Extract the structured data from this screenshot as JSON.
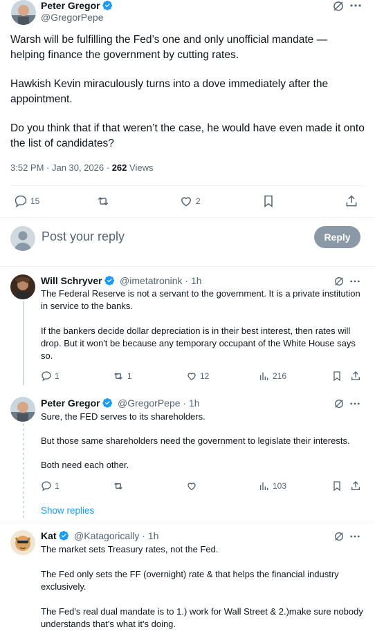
{
  "main_tweet": {
    "author_name": "Peter Gregor",
    "author_handle": "@GregorPepe",
    "paragraphs": [
      "Warsh will be fulfilling the Fed’s one and only unofficial mandate — helping finance the government by cutting rates.",
      "Hawkish Kevin miraculously turns into a dove immediately after the appointment.",
      "Do you think that if that weren’t the case, he would have even made it onto the list of candidates?"
    ],
    "timestamp": "3:52 PM · Jan 30, 2026 · ",
    "views_count": "262",
    "views_label": " Views",
    "replies": "15",
    "reposts": "",
    "likes": "2"
  },
  "composer": {
    "placeholder": "Post your reply",
    "button_label": "Reply"
  },
  "replies": [
    {
      "name": "Will Schryver",
      "handle": "@imetatronink · 1h",
      "paragraphs": [
        "The Federal Reserve is not a servant to the government. It is a private institution in service to the banks.",
        "If the bankers decide dollar depreciation is in their best interest, then rates will drop. But it won't be because any temporary occupant of the White House says so."
      ],
      "replies": "1",
      "reposts": "1",
      "likes": "12",
      "views": "216"
    },
    {
      "name": "Peter Gregor",
      "handle": "@GregorPepe · 1h",
      "paragraphs": [
        "Sure, the FED serves to its shareholders.",
        "But those same shareholders need the government to legislate their interests.",
        "Both need each other."
      ],
      "replies": "1",
      "reposts": "",
      "likes": "",
      "views": "103"
    },
    {
      "name": "Kat",
      "handle": "@Katagorically · 1h",
      "paragraphs": [
        "The market sets Treasury rates, not the Fed.",
        "The Fed only sets the FF (overnight) rate & that helps the financial industry exclusively.",
        "The Fed's real dual mandate is to 1.) work for Wall Street & 2.)make sure nobody understands that's what it's doing."
      ]
    }
  ],
  "show_replies_label": "Show replies",
  "colors": {
    "accent": "#1d9bf0",
    "muted": "#536471",
    "button_disabled": "#8b98a5"
  }
}
